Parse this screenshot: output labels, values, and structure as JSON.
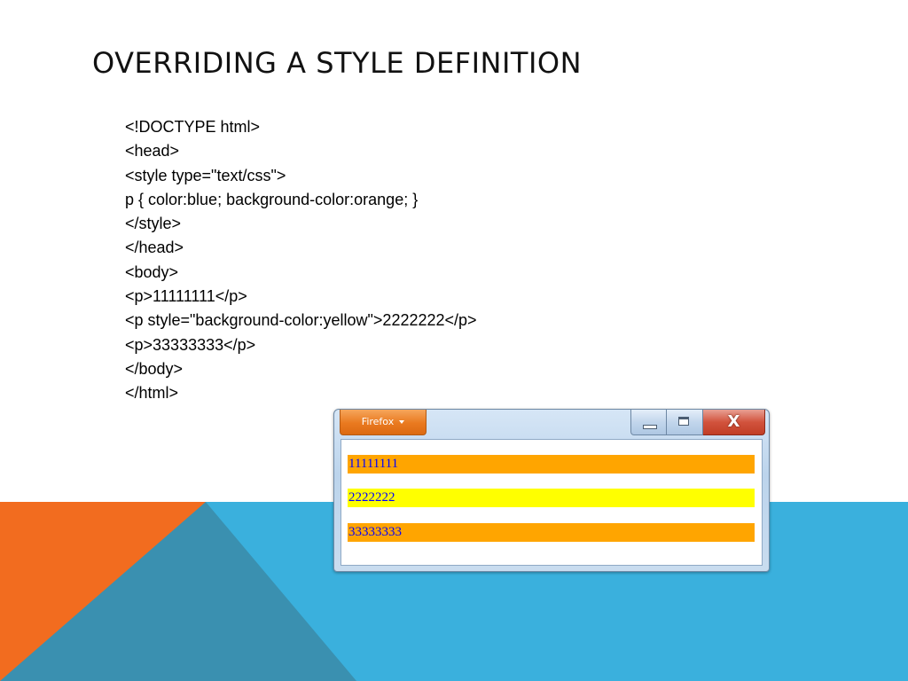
{
  "slide": {
    "title": "OVERRIDING A STYLE DEFINITION",
    "code_lines": [
      "<!DOCTYPE html>",
      "<head>",
      "<style type=\"text/css\">",
      "p { color:blue; background-color:orange; }",
      "</style>",
      "</head>",
      "<body>",
      "<p>11111111</p>",
      "<p style=\"background-color:yellow\">2222222</p>",
      "<p>33333333</p>",
      "</body>",
      "</html>"
    ]
  },
  "browser": {
    "menu_label": "Firefox",
    "close_glyph": "X",
    "paragraphs": [
      {
        "text": "11111111",
        "background": "#ffa500",
        "color": "#0000ff"
      },
      {
        "text": "2222222",
        "background": "#ffff00",
        "color": "#0000ff"
      },
      {
        "text": "33333333",
        "background": "#ffa500",
        "color": "#0000ff"
      }
    ]
  },
  "theme": {
    "orange": "#f26c1f",
    "dark_teal": "#3a90b0",
    "light_blue": "#3ab0dd"
  }
}
